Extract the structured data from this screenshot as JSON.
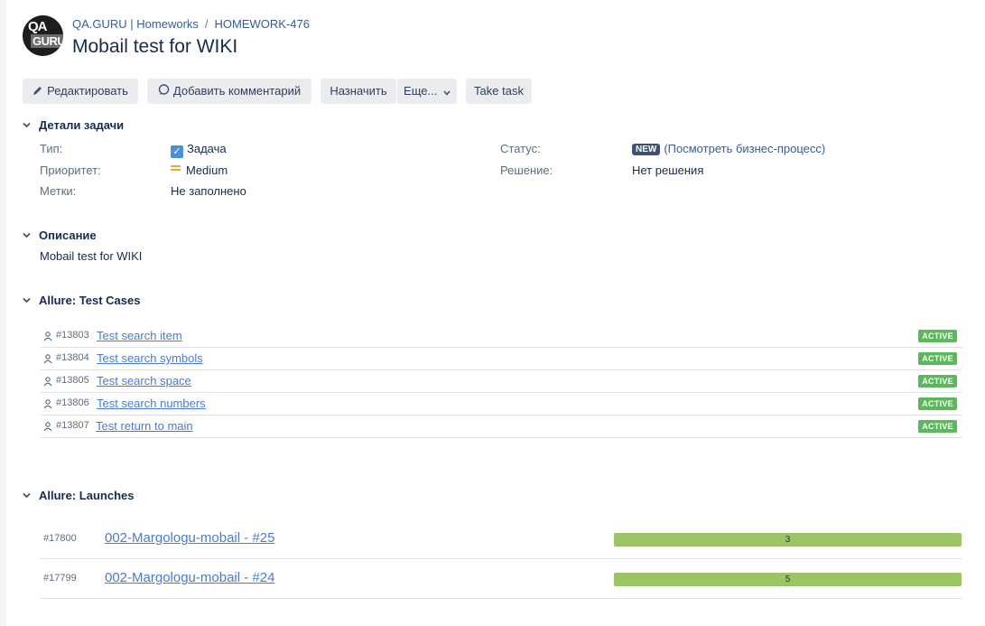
{
  "header": {
    "logo_top": "QA",
    "logo_bottom": "GURU",
    "breadcrumb": [
      "QA.GURU | Homeworks",
      "HOMEWORK-476"
    ],
    "breadcrumb_sep": "/",
    "title": "Mobail test for WIKI"
  },
  "toolbar": {
    "edit_label": "Редактировать",
    "comment_label": "Добавить комментарий",
    "assign_label": "Назначить",
    "more_label": "Еще...",
    "take_label": "Take task"
  },
  "details": {
    "section_title": "Детали задачи",
    "type_label": "Тип:",
    "type_value": "Задача",
    "priority_label": "Приоритет:",
    "priority_value": "Medium",
    "labels_label": "Метки:",
    "labels_value": "Не заполнено",
    "status_label": "Статус:",
    "status_value": "NEW",
    "status_link": "(Посмотреть бизнес-процесс)",
    "resolution_label": "Решение:",
    "resolution_value": "Нет решения"
  },
  "description": {
    "section_title": "Описание",
    "text": "Mobail test for WIKI"
  },
  "test_cases": {
    "section_title": "Allure: Test Cases",
    "items": [
      {
        "id": "#13803",
        "name": "Test search item",
        "status": "ACTIVE"
      },
      {
        "id": "#13804",
        "name": "Test search symbols",
        "status": "ACTIVE"
      },
      {
        "id": "#13805",
        "name": "Test search space",
        "status": "ACTIVE"
      },
      {
        "id": "#13806",
        "name": "Test search numbers",
        "status": "ACTIVE"
      },
      {
        "id": "#13807",
        "name": "Test return to main",
        "status": "ACTIVE"
      }
    ]
  },
  "launches": {
    "section_title": "Allure: Launches",
    "items": [
      {
        "id": "#17800",
        "name": "002-Margologu-mobail - #25",
        "count": "3"
      },
      {
        "id": "#17799",
        "name": "002-Margologu-mobail - #24",
        "count": "5"
      }
    ]
  },
  "colors": {
    "active_badge": "#5cb85c",
    "launch_bar": "#9bc565",
    "link": "#4a7bd0"
  }
}
